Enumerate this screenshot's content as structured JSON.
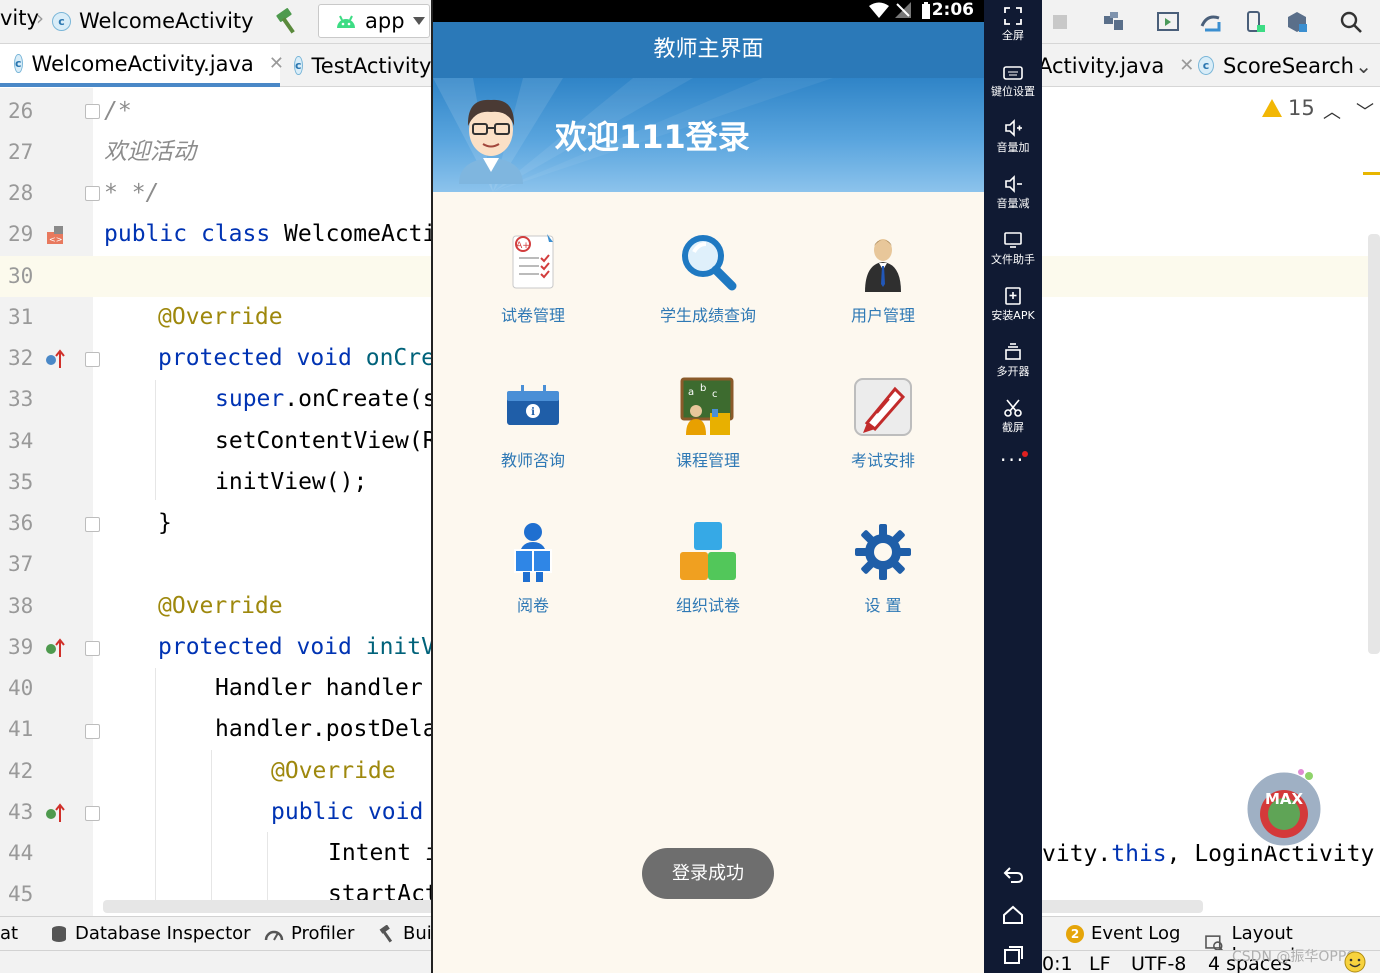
{
  "ide": {
    "breadcrumb_prefix": "vity",
    "breadcrumb_file": "WelcomeActivity",
    "run_config": "app",
    "tabs": [
      {
        "label": "WelcomeActivity.java",
        "active": true
      },
      {
        "label": "TestActivity"
      },
      {
        "label": "Activity.java"
      },
      {
        "label": "ScoreSearch"
      }
    ],
    "warning_count": "15",
    "accent_color": "#4a88c7"
  },
  "code_lines": [
    {
      "no": "26",
      "text": "/*"
    },
    {
      "no": "27",
      "text": "欢迎活动"
    },
    {
      "no": "28",
      "text": "* */"
    },
    {
      "no": "29",
      "kw1": "public",
      "kw2": "class",
      "rest": " WelcomeActi"
    },
    {
      "no": "30",
      "text": ""
    },
    {
      "no": "31",
      "ann": "@Override"
    },
    {
      "no": "32",
      "kw1": "protected",
      "kw2": "void",
      "fn": "onCre"
    },
    {
      "no": "33",
      "kw1": "super",
      "rest": ".onCreate(s"
    },
    {
      "no": "34",
      "text": "setContentView(R"
    },
    {
      "no": "35",
      "text": "initView();"
    },
    {
      "no": "36",
      "text": "}"
    },
    {
      "no": "37",
      "text": ""
    },
    {
      "no": "38",
      "ann": "@Override"
    },
    {
      "no": "39",
      "kw1": "protected",
      "kw2": "void",
      "fn": "initV"
    },
    {
      "no": "40",
      "text": "Handler handler "
    },
    {
      "no": "41",
      "text": "handler.postDela"
    },
    {
      "no": "42",
      "ann": "@Override"
    },
    {
      "no": "43",
      "kw1": "public",
      "kw2": "void"
    },
    {
      "no": "44",
      "text": "Intent i"
    },
    {
      "no": "45",
      "text": "startAct"
    }
  ],
  "code_right": {
    "pre": "vity.",
    "kw": "this",
    "post": ", LoginActivity"
  },
  "bottom_tools": [
    "at",
    "Database Inspector",
    "Profiler",
    "Bui",
    "Event Log",
    "Layout Inspector"
  ],
  "event_log_count": "2",
  "status": {
    "pos": "0:1",
    "line_sep": "LF",
    "encoding": "UTF-8",
    "indent": "4 spaces"
  },
  "watermark": "CSDN @振华OPPO",
  "phone": {
    "time": "2:06",
    "title": "教师主界面",
    "welcome": "欢迎111登录",
    "menu": [
      {
        "label": "试卷管理",
        "icon": "exam-paper-icon"
      },
      {
        "label": "学生成绩查询",
        "icon": "magnifier-icon"
      },
      {
        "label": "用户管理",
        "icon": "user-icon"
      },
      {
        "label": "教师咨询",
        "icon": "info-box-icon"
      },
      {
        "label": "课程管理",
        "icon": "blackboard-icon"
      },
      {
        "label": "考试安排",
        "icon": "pen-icon"
      },
      {
        "label": "阅卷",
        "icon": "reader-icon"
      },
      {
        "label": "组织试卷",
        "icon": "blocks-icon"
      },
      {
        "label": "设  置",
        "icon": "gear-icon"
      }
    ],
    "toast": "登录成功",
    "appbar_color": "#2b79b8"
  },
  "emulator": {
    "buttons": [
      "全屏",
      "键位设置",
      "音量加",
      "音量减",
      "文件助手",
      "安装APK",
      "多开器",
      "截屏"
    ],
    "more": "···"
  }
}
